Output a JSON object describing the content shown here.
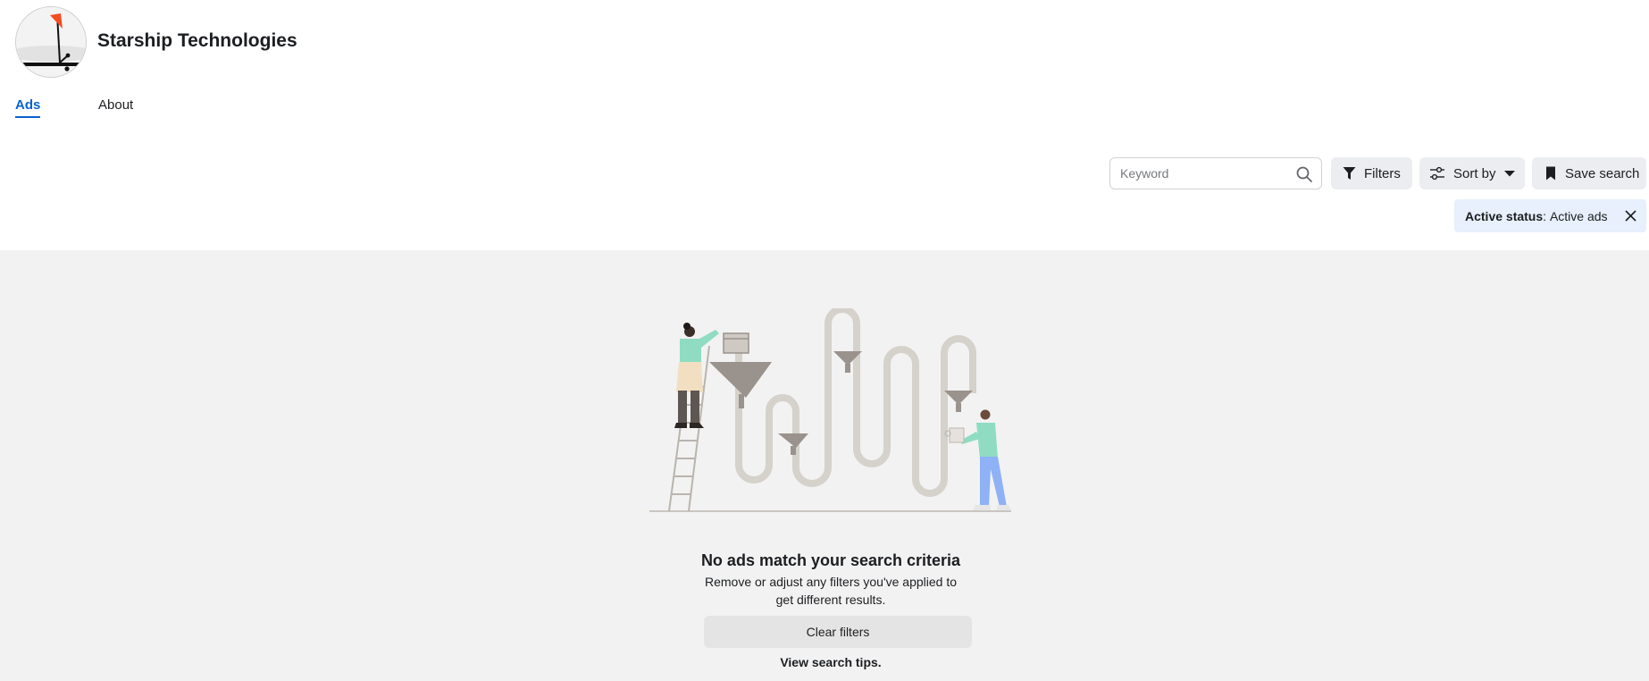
{
  "page": {
    "name": "Starship Technologies"
  },
  "tabs": [
    {
      "label": "Ads",
      "active": true
    },
    {
      "label": "About",
      "active": false
    }
  ],
  "search": {
    "placeholder": "Keyword",
    "value": ""
  },
  "toolbar": {
    "filters_label": "Filters",
    "sort_label": "Sort by",
    "save_label": "Save search"
  },
  "active_filter": {
    "key": "Active status",
    "separator": ":",
    "value": "Active ads"
  },
  "empty_state": {
    "title": "No ads match your search criteria",
    "description": "Remove or adjust any filters you've applied to get different results.",
    "clear_label": "Clear filters",
    "tips_label": "View search tips."
  },
  "icons": {
    "search": "magnifier-icon",
    "filters": "funnel-icon",
    "sort": "sliders-icon",
    "save": "bookmark-icon",
    "close": "close-icon"
  },
  "colors": {
    "accent": "#0a62d0",
    "chip_bg": "#e7f0fc",
    "button_bg": "#ebedf0",
    "content_bg": "#f2f2f2",
    "logo_flag": "#f04e23"
  }
}
